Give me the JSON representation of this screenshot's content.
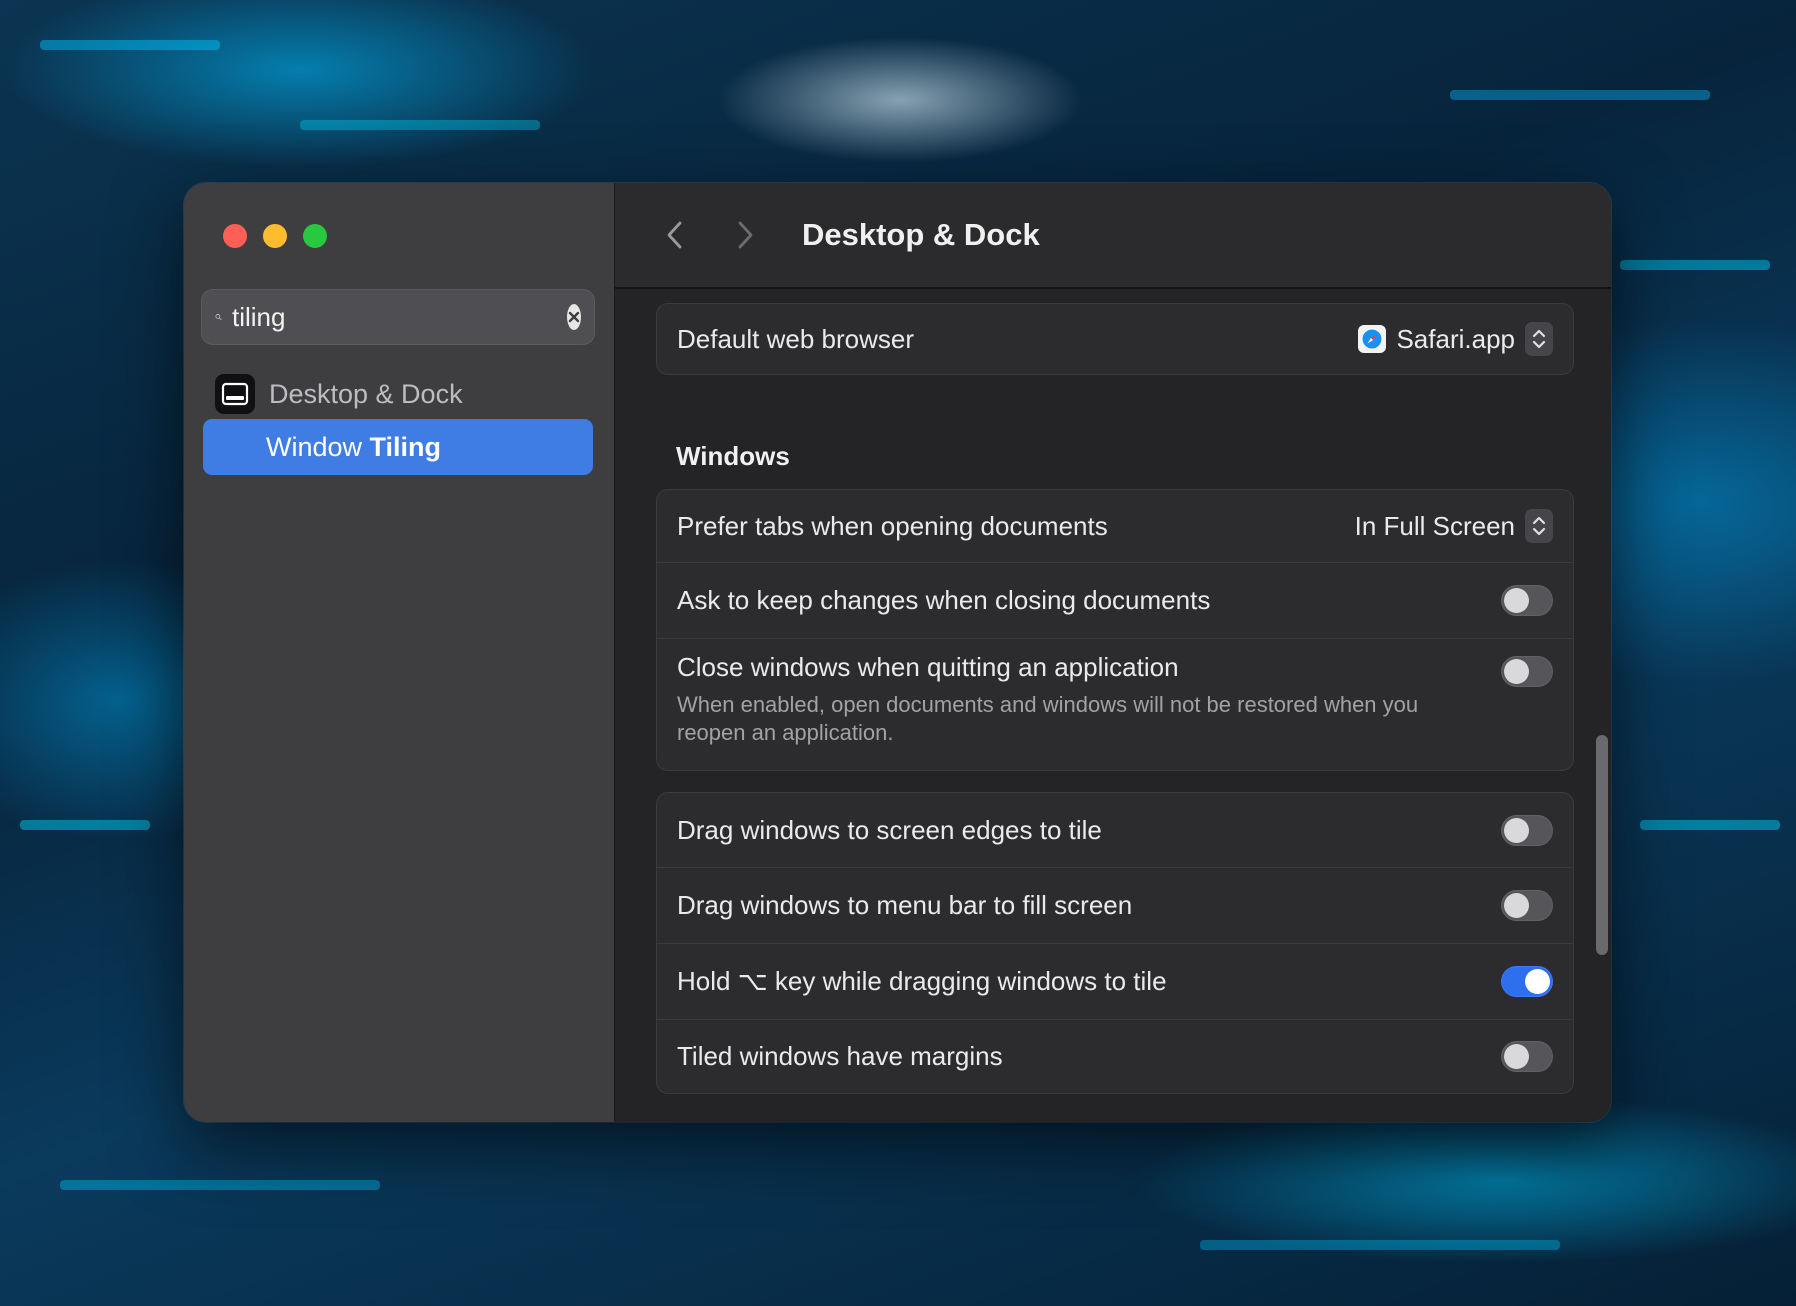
{
  "window": {
    "title": "Desktop & Dock"
  },
  "sidebar": {
    "search": {
      "value": "tiling",
      "placeholder": "Search"
    },
    "category": {
      "label": "Desktop & Dock",
      "icon": "desktop-dock-icon"
    },
    "selected_item": {
      "label_prefix": "Window ",
      "label_match": "Tiling"
    }
  },
  "main": {
    "default_browser": {
      "label": "Default web browser",
      "value": "Safari.app",
      "icon": "safari-icon"
    },
    "windows_section": {
      "heading": "Windows",
      "prefer_tabs": {
        "label": "Prefer tabs when opening documents",
        "value": "In Full Screen"
      },
      "ask_keep_changes": {
        "label": "Ask to keep changes when closing documents",
        "enabled": false
      },
      "close_windows": {
        "label": "Close windows when quitting an application",
        "description": "When enabled, open documents and windows will not be restored when you reopen an application.",
        "enabled": false
      }
    },
    "tiling_group": {
      "drag_edges": {
        "label": "Drag windows to screen edges to tile",
        "enabled": false
      },
      "drag_menubar": {
        "label": "Drag windows to menu bar to fill screen",
        "enabled": false
      },
      "hold_option": {
        "label": "Hold ⌥ key while dragging windows to tile",
        "enabled": true
      },
      "tiled_margins": {
        "label": "Tiled windows have margins",
        "enabled": false
      }
    }
  },
  "colors": {
    "accent": "#3f7ce4",
    "toggle_on": "#2e6ff0",
    "close": "#ff5f57",
    "minimize": "#febc2e",
    "zoom": "#28c840"
  }
}
